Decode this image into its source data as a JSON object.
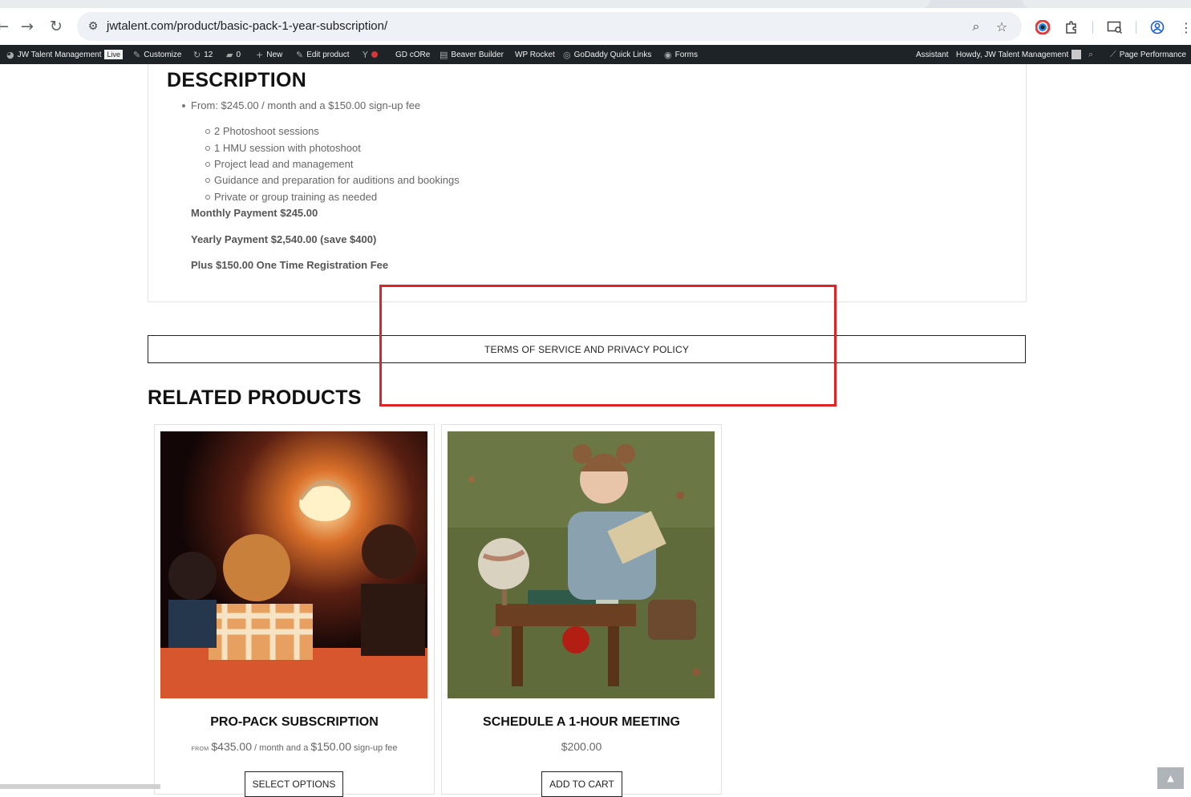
{
  "browser": {
    "url": "jwtalent.com/product/basic-pack-1-year-subscription/"
  },
  "adminbar": {
    "site_name": "JW Talent Management",
    "live_badge": "Live",
    "customize": "Customize",
    "updates_count": "12",
    "comments_count": "0",
    "new": "New",
    "edit_product": "Edit product",
    "gd_core": "GD cORe",
    "beaver_builder": "Beaver Builder",
    "wp_rocket": "WP Rocket",
    "godaddy_quick_links": "GoDaddy Quick Links",
    "forms": "Forms",
    "assistant": "Assistant",
    "howdy": "Howdy, JW Talent Management",
    "page_performance": "Page Performance"
  },
  "description": {
    "heading": "DESCRIPTION",
    "from_line": "From: $245.00 / month and a $150.00 sign-up fee",
    "features": [
      "2 Photoshoot sessions",
      "1 HMU session with photoshoot",
      "Project lead and management",
      "Guidance and preparation for auditions and bookings",
      "Private or group training as needed"
    ],
    "monthly": "Monthly Payment $245.00",
    "yearly": "Yearly Payment $2,540.00 (save $400)",
    "registration": "Plus $150.00 One Time Registration Fee"
  },
  "terms": {
    "label": "TERMS OF SERVICE AND PRIVACY POLICY"
  },
  "related": {
    "heading": "RELATED PRODUCTS",
    "products": [
      {
        "title": "PRO-PACK SUBSCRIPTION",
        "price_from": "FROM",
        "price": "$435.00",
        "price_mid": " / month and a ",
        "fee": "$150.00",
        "price_suffix": " sign-up fee",
        "button": "SELECT OPTIONS"
      },
      {
        "title": "SCHEDULE A 1-HOUR MEETING",
        "price": "$200.00",
        "button": "ADD TO CART"
      }
    ]
  },
  "colors": {
    "adminbar_bg": "#1d2327",
    "highlight_rect": "#e02424"
  }
}
